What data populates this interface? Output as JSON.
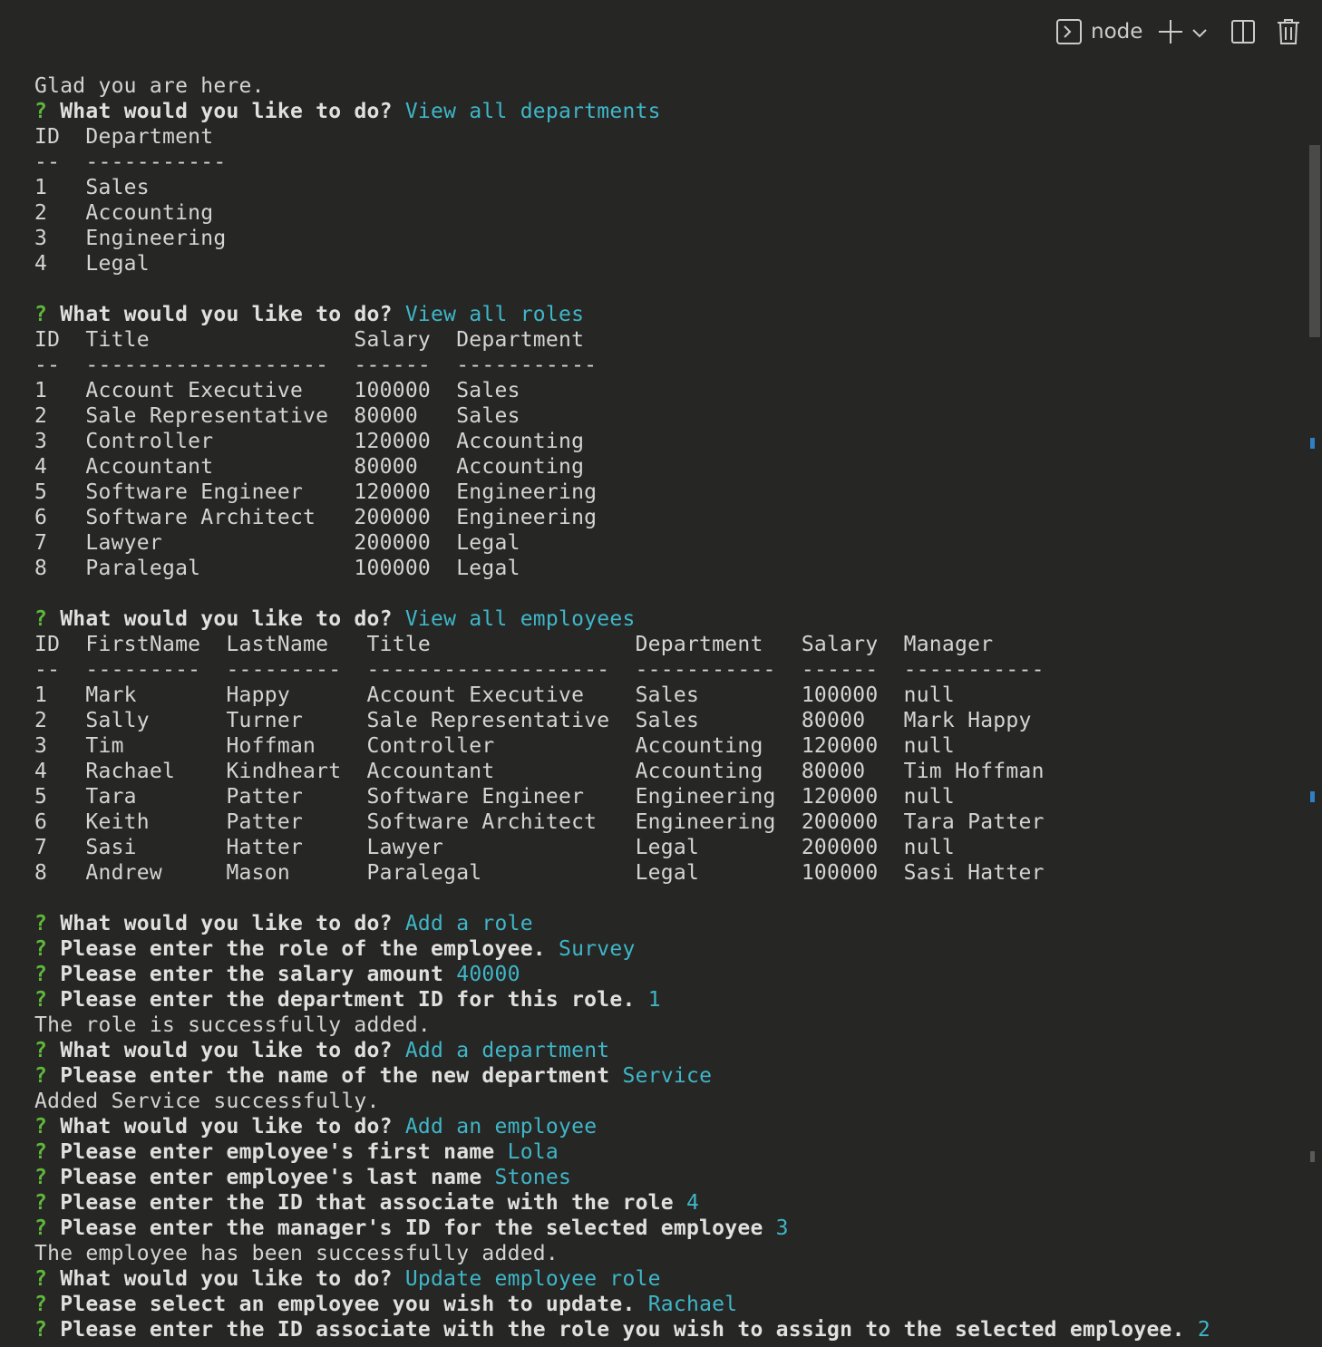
{
  "toolbar": {
    "shell_name": "node",
    "icons": [
      "terminal-icon",
      "add-icon",
      "chevron-down-icon",
      "split-icon",
      "trash-icon"
    ]
  },
  "colors": {
    "prompt": "#5fb83a",
    "answer": "#3fb6c8",
    "text": "#d4d4d4",
    "bg": "#262624"
  },
  "lines": [
    [
      {
        "t": "Glad you are here."
      }
    ],
    [
      {
        "c": "q",
        "t": "? "
      },
      {
        "c": "b",
        "t": "What would you like to do? "
      },
      {
        "c": "a",
        "t": "View all departments"
      }
    ],
    [
      {
        "t": "ID  Department"
      }
    ],
    [
      {
        "t": "--  -----------"
      }
    ],
    [
      {
        "t": "1   Sales"
      }
    ],
    [
      {
        "t": "2   Accounting"
      }
    ],
    [
      {
        "t": "3   Engineering"
      }
    ],
    [
      {
        "t": "4   Legal"
      }
    ],
    [
      {
        "t": ""
      }
    ],
    [
      {
        "c": "q",
        "t": "? "
      },
      {
        "c": "b",
        "t": "What would you like to do? "
      },
      {
        "c": "a",
        "t": "View all roles"
      }
    ],
    [
      {
        "t": "ID  Title                Salary  Department"
      }
    ],
    [
      {
        "t": "--  -------------------  ------  -----------"
      }
    ],
    [
      {
        "t": "1   Account Executive    100000  Sales"
      }
    ],
    [
      {
        "t": "2   Sale Representative  80000   Sales"
      }
    ],
    [
      {
        "t": "3   Controller           120000  Accounting"
      }
    ],
    [
      {
        "t": "4   Accountant           80000   Accounting"
      }
    ],
    [
      {
        "t": "5   Software Engineer    120000  Engineering"
      }
    ],
    [
      {
        "t": "6   Software Architect   200000  Engineering"
      }
    ],
    [
      {
        "t": "7   Lawyer               200000  Legal"
      }
    ],
    [
      {
        "t": "8   Paralegal            100000  Legal"
      }
    ],
    [
      {
        "t": ""
      }
    ],
    [
      {
        "c": "q",
        "t": "? "
      },
      {
        "c": "b",
        "t": "What would you like to do? "
      },
      {
        "c": "a",
        "t": "View all employees"
      }
    ],
    [
      {
        "t": "ID  FirstName  LastName   Title                Department   Salary  Manager"
      }
    ],
    [
      {
        "t": "--  ---------  ---------  -------------------  -----------  ------  -----------"
      }
    ],
    [
      {
        "t": "1   Mark       Happy      Account Executive    Sales        100000  null"
      }
    ],
    [
      {
        "t": "2   Sally      Turner     Sale Representative  Sales        80000   Mark Happy"
      }
    ],
    [
      {
        "t": "3   Tim        Hoffman    Controller           Accounting   120000  null"
      }
    ],
    [
      {
        "t": "4   Rachael    Kindheart  Accountant           Accounting   80000   Tim Hoffman"
      }
    ],
    [
      {
        "t": "5   Tara       Patter     Software Engineer    Engineering  120000  null"
      }
    ],
    [
      {
        "t": "6   Keith      Patter     Software Architect   Engineering  200000  Tara Patter"
      }
    ],
    [
      {
        "t": "7   Sasi       Hatter     Lawyer               Legal        200000  null"
      }
    ],
    [
      {
        "t": "8   Andrew     Mason      Paralegal            Legal        100000  Sasi Hatter"
      }
    ],
    [
      {
        "t": ""
      }
    ],
    [
      {
        "c": "q",
        "t": "? "
      },
      {
        "c": "b",
        "t": "What would you like to do? "
      },
      {
        "c": "a",
        "t": "Add a role"
      }
    ],
    [
      {
        "c": "q",
        "t": "? "
      },
      {
        "c": "b",
        "t": "Please enter the role of the employee. "
      },
      {
        "c": "a",
        "t": "Survey"
      }
    ],
    [
      {
        "c": "q",
        "t": "? "
      },
      {
        "c": "b",
        "t": "Please enter the salary amount "
      },
      {
        "c": "a",
        "t": "40000"
      }
    ],
    [
      {
        "c": "q",
        "t": "? "
      },
      {
        "c": "b",
        "t": "Please enter the department ID for this role. "
      },
      {
        "c": "a",
        "t": "1"
      }
    ],
    [
      {
        "t": "The role is successfully added."
      }
    ],
    [
      {
        "c": "q",
        "t": "? "
      },
      {
        "c": "b",
        "t": "What would you like to do? "
      },
      {
        "c": "a",
        "t": "Add a department"
      }
    ],
    [
      {
        "c": "q",
        "t": "? "
      },
      {
        "c": "b",
        "t": "Please enter the name of the new department "
      },
      {
        "c": "a",
        "t": "Service"
      }
    ],
    [
      {
        "t": "Added Service successfully."
      }
    ],
    [
      {
        "c": "q",
        "t": "? "
      },
      {
        "c": "b",
        "t": "What would you like to do? "
      },
      {
        "c": "a",
        "t": "Add an employee"
      }
    ],
    [
      {
        "c": "q",
        "t": "? "
      },
      {
        "c": "b",
        "t": "Please enter employee's first name "
      },
      {
        "c": "a",
        "t": "Lola"
      }
    ],
    [
      {
        "c": "q",
        "t": "? "
      },
      {
        "c": "b",
        "t": "Please enter employee's last name "
      },
      {
        "c": "a",
        "t": "Stones"
      }
    ],
    [
      {
        "c": "q",
        "t": "? "
      },
      {
        "c": "b",
        "t": "Please enter the ID that associate with the role "
      },
      {
        "c": "a",
        "t": "4"
      }
    ],
    [
      {
        "c": "q",
        "t": "? "
      },
      {
        "c": "b",
        "t": "Please enter the manager's ID for the selected employee "
      },
      {
        "c": "a",
        "t": "3"
      }
    ],
    [
      {
        "t": "The employee has been successfully added."
      }
    ],
    [
      {
        "c": "q",
        "t": "? "
      },
      {
        "c": "b",
        "t": "What would you like to do? "
      },
      {
        "c": "a",
        "t": "Update employee role"
      }
    ],
    [
      {
        "c": "q",
        "t": "? "
      },
      {
        "c": "b",
        "t": "Please select an employee you wish to update. "
      },
      {
        "c": "a",
        "t": "Rachael"
      }
    ],
    [
      {
        "c": "q",
        "t": "? "
      },
      {
        "c": "b",
        "t": "Please enter the ID associate with the role you wish to assign to the selected employee. "
      },
      {
        "c": "a",
        "t": "2"
      }
    ]
  ]
}
